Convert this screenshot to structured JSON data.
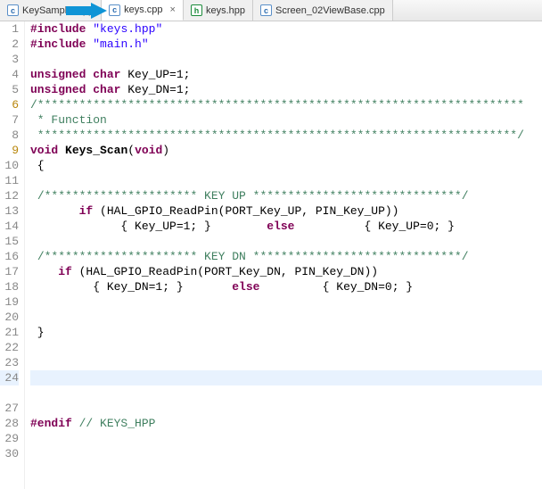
{
  "tabs": [
    {
      "label": "KeySampler.cpp",
      "type": "cpp",
      "active": false
    },
    {
      "label": "keys.cpp",
      "type": "cpp",
      "active": true
    },
    {
      "label": "keys.hpp",
      "type": "hpp",
      "active": false
    },
    {
      "label": "Screen_02ViewBase.cpp",
      "type": "cpp",
      "active": false
    }
  ],
  "arrow_color": "#0f94d6",
  "code": {
    "lines": [
      {
        "n": 1,
        "html": "<span class='pre'>#include</span> <span class='str'>\"keys.hpp\"</span>"
      },
      {
        "n": 2,
        "html": "<span class='pre'>#include</span> <span class='str'>\"main.h\"</span>"
      },
      {
        "n": 3,
        "html": ""
      },
      {
        "n": 4,
        "html": "<span class='kw'>unsigned</span> <span class='kw'>char</span> Key_UP=1;"
      },
      {
        "n": 5,
        "html": "<span class='kw'>unsigned</span> <span class='kw'>char</span> Key_DN=1;"
      },
      {
        "n": 6,
        "anno": true,
        "html": "<span class='cmt'>/**********************************************************************</span>"
      },
      {
        "n": 7,
        "html": "<span class='cmt'> * Function</span>"
      },
      {
        "n": 8,
        "html": "<span class='cmt'> *********************************************************************/</span>"
      },
      {
        "n": 9,
        "anno": true,
        "html": "<span class='kw'>void</span> <span class='fn'>Keys_Scan</span>(<span class='kw'>void</span>)"
      },
      {
        "n": 10,
        "html": " {"
      },
      {
        "n": 11,
        "html": ""
      },
      {
        "n": 12,
        "html": " <span class='cmt'>/********************** KEY UP ******************************/</span>"
      },
      {
        "n": 13,
        "html": "       <span class='kw'>if</span> (HAL_GPIO_ReadPin(PORT_Key_UP, PIN_Key_UP))"
      },
      {
        "n": 14,
        "html": "             { Key_UP=1; }        <span class='kw'>else</span>          { Key_UP=0; }"
      },
      {
        "n": 15,
        "html": ""
      },
      {
        "n": 16,
        "html": " <span class='cmt'>/********************** KEY DN ******************************/</span>"
      },
      {
        "n": 17,
        "html": "    <span class='kw'>if</span> (HAL_GPIO_ReadPin(PORT_Key_DN, PIN_Key_DN))"
      },
      {
        "n": 18,
        "html": "         { Key_DN=1; }       <span class='kw'>else</span>         { Key_DN=0; }"
      },
      {
        "n": 19,
        "html": ""
      },
      {
        "n": 20,
        "html": ""
      },
      {
        "n": 21,
        "html": " }"
      },
      {
        "n": 22,
        "html": ""
      },
      {
        "n": 23,
        "html": ""
      },
      {
        "n": 24,
        "highlight": true,
        "html": ""
      },
      {
        "n": "",
        "html": ""
      },
      {
        "n": 27,
        "html": ""
      },
      {
        "n": 28,
        "html": "<span class='pre'>#endif</span> <span class='cmt'>// KEYS_HPP</span>"
      },
      {
        "n": 29,
        "html": ""
      },
      {
        "n": 30,
        "html": ""
      }
    ]
  }
}
